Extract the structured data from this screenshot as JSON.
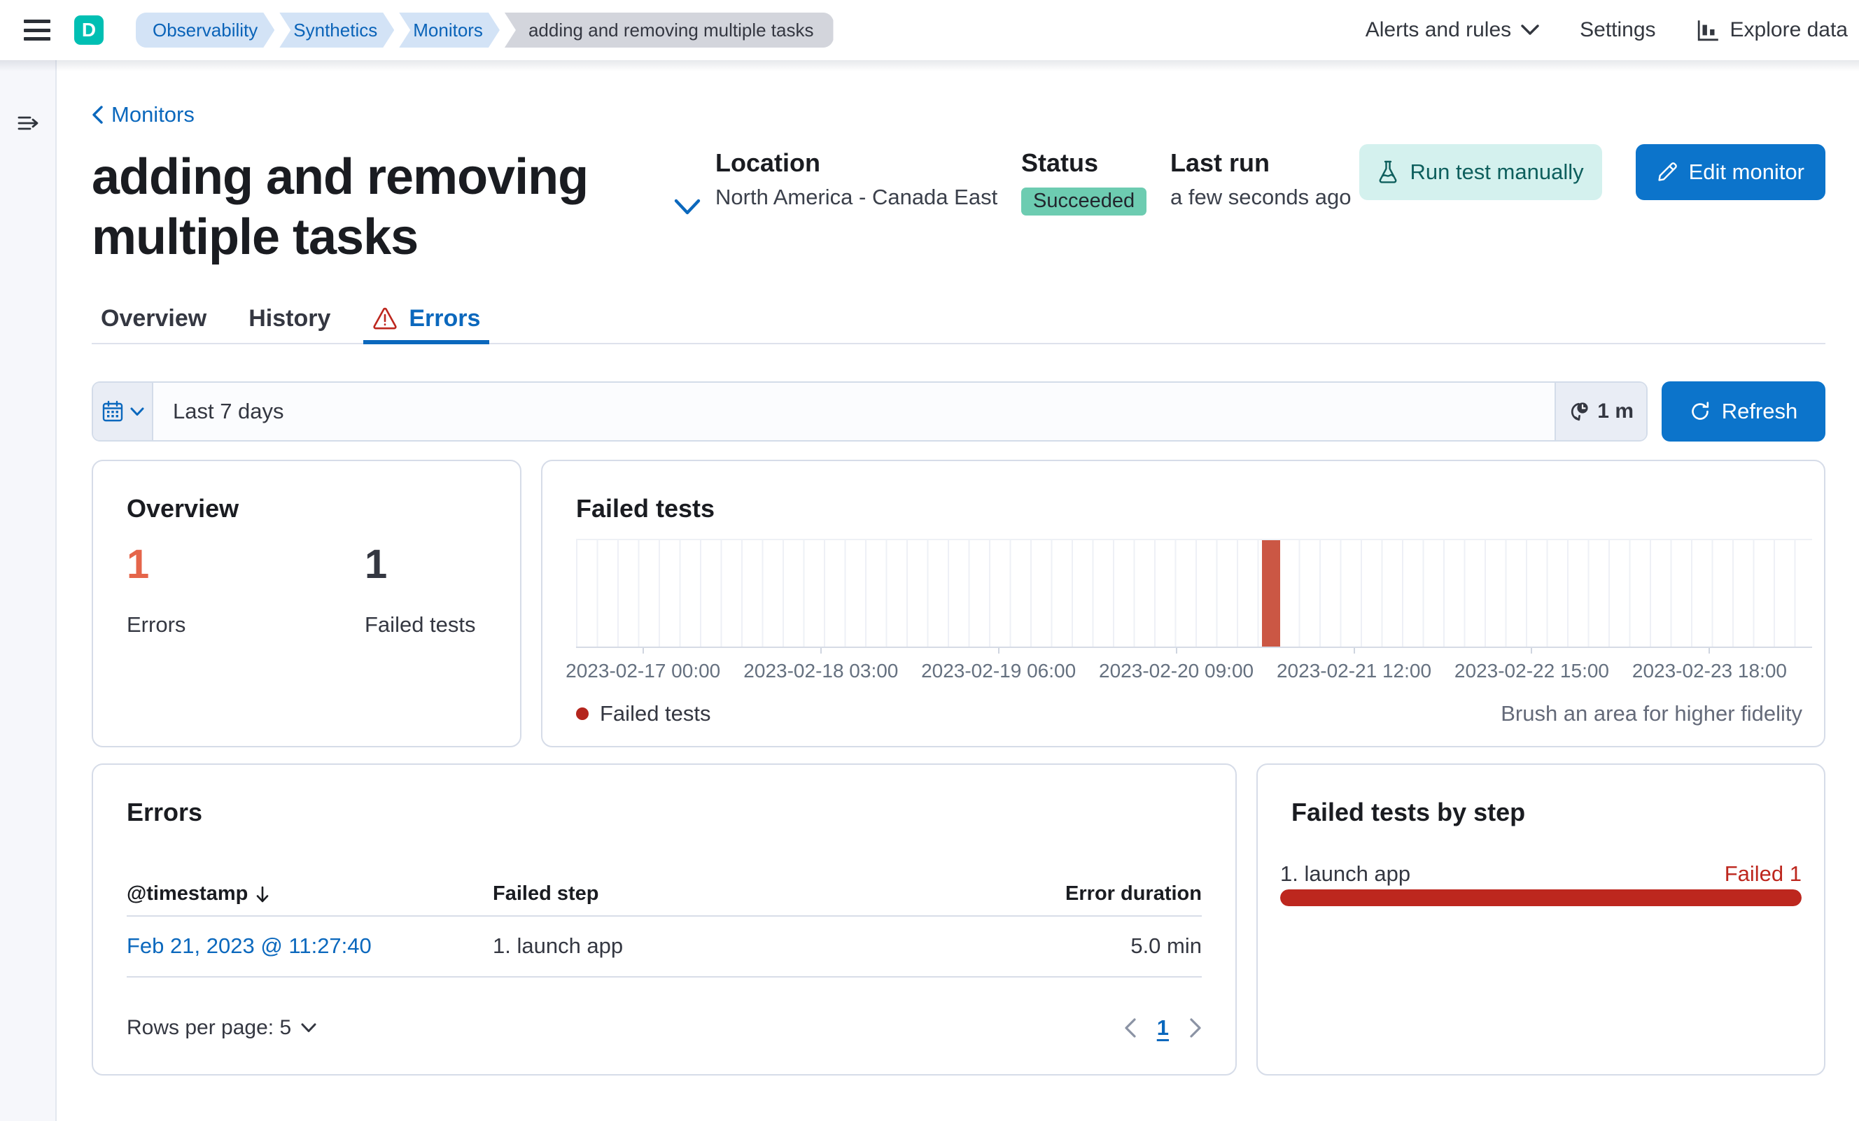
{
  "colors": {
    "primary_fill": "#0c74cb",
    "link_blue": "#0b68bd",
    "danger": "#bd271e",
    "chart_bar": "#cb5744",
    "legend_dot": "#b4251d",
    "stat_error": "#e5654a",
    "stat_dark": "#343741",
    "badge_success_bg": "#6dccb1",
    "avatar_bg": "#00bfb3"
  },
  "header": {
    "avatar_initial": "D",
    "breadcrumbs": [
      "Observability",
      "Synthetics",
      "Monitors",
      "adding and removing multiple tasks"
    ],
    "alerts_menu_label": "Alerts and rules",
    "settings_label": "Settings",
    "explore_label": "Explore data"
  },
  "page": {
    "back_link_label": "Monitors",
    "title": "adding and removing multiple tasks",
    "meta": {
      "location_label": "Location",
      "location_value": "North America - Canada East",
      "status_label": "Status",
      "status_value": "Succeeded",
      "last_run_label": "Last run",
      "last_run_value": "a few seconds ago"
    },
    "actions": {
      "run_test_label": "Run test manually",
      "edit_monitor_label": "Edit monitor"
    },
    "tabs": [
      {
        "label": "Overview",
        "selected": false
      },
      {
        "label": "History",
        "selected": false
      },
      {
        "label": "Errors",
        "selected": true
      }
    ]
  },
  "time_bar": {
    "range_value": "Last 7 days",
    "refresh_interval": "1 m",
    "refresh_label": "Refresh"
  },
  "overview_panel": {
    "title": "Overview",
    "stats": [
      {
        "value": "1",
        "label": "Errors"
      },
      {
        "value": "1",
        "label": "Failed tests"
      }
    ]
  },
  "chart_data": {
    "type": "bar",
    "title": "Failed tests",
    "series": [
      {
        "name": "Failed tests",
        "color": "#cb5744"
      }
    ],
    "x_tick_labels": [
      "2023-02-17 00:00",
      "2023-02-18 03:00",
      "2023-02-19 06:00",
      "2023-02-20 09:00",
      "2023-02-21 12:00",
      "2023-02-22 15:00",
      "2023-02-23 18:00"
    ],
    "x_tick_fractions": [
      0.0542,
      0.1981,
      0.3418,
      0.4856,
      0.6294,
      0.7732,
      0.917
    ],
    "bars": [
      {
        "x_label": "2023-02-21 11:00",
        "value": 1,
        "left_fraction": 0.5548,
        "width_fraction": 0.0147
      }
    ],
    "ylim": [
      0,
      1
    ],
    "grid": true,
    "legend": [
      {
        "label": "Failed tests",
        "color": "#b4251d"
      }
    ],
    "note": "Brush an area for higher fidelity"
  },
  "errors_panel": {
    "title": "Errors",
    "columns": [
      "@timestamp",
      "Failed step",
      "Error duration"
    ],
    "rows": [
      {
        "timestamp": "Feb 21, 2023 @ 11:27:40",
        "failed_step": "1. launch app",
        "error_duration": "5.0 min"
      }
    ],
    "rows_per_page_label": "Rows per page: 5",
    "page_number": "1"
  },
  "bystep_panel": {
    "title": "Failed tests by step",
    "items": [
      {
        "label": "1. launch app",
        "status": "Failed 1",
        "fraction": 1
      }
    ]
  }
}
